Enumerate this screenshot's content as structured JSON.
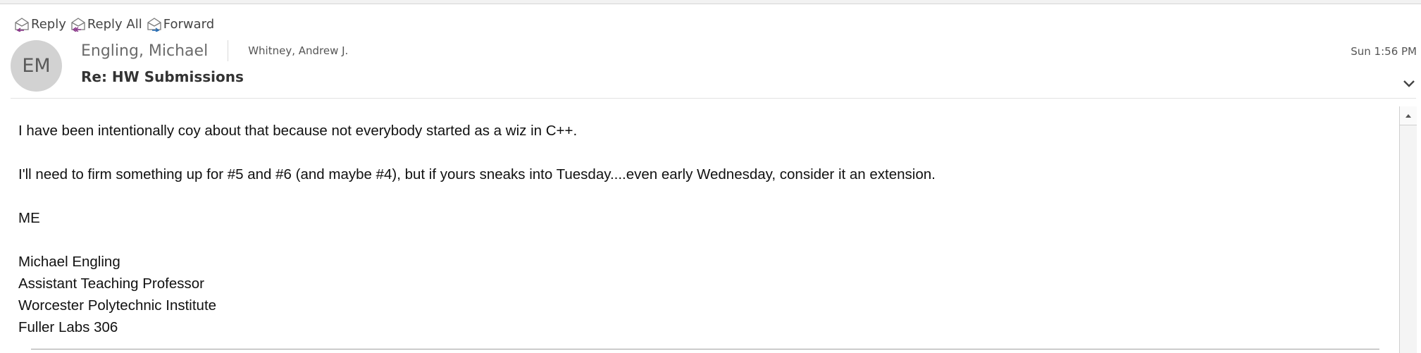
{
  "toolbar": {
    "reply_label": "Reply",
    "reply_all_label": "Reply All",
    "forward_label": "Forward"
  },
  "message": {
    "avatar_initials": "EM",
    "sender_name": "Engling, Michael",
    "recipient": "Whitney, Andrew J.",
    "timestamp": "Sun 1:56 PM",
    "subject": "Re: HW Submissions",
    "body": {
      "para1": "I have been intentionally coy about that because not everybody started as a wiz in C++.",
      "para2": "I'll need to firm something up for #5 and #6 (and maybe #4), but if yours sneaks into Tuesday....even early Wednesday, consider it an extension.",
      "para3": "ME",
      "signature": {
        "name": "Michael Engling",
        "title": "Assistant Teaching Professor",
        "institution": "Worcester Polytechnic Institute",
        "office": "Fuller Labs 306"
      }
    }
  },
  "colors": {
    "avatar_bg": "#d2d2d2",
    "reply_arrow": "#8b3a8b",
    "forward_arrow": "#2a6fb5"
  },
  "icons": {
    "reply": "reply-envelope-icon",
    "reply_all": "reply-all-envelope-icon",
    "forward": "forward-envelope-icon",
    "expand": "chevron-down-icon",
    "scroll_up": "triangle-up-icon"
  }
}
